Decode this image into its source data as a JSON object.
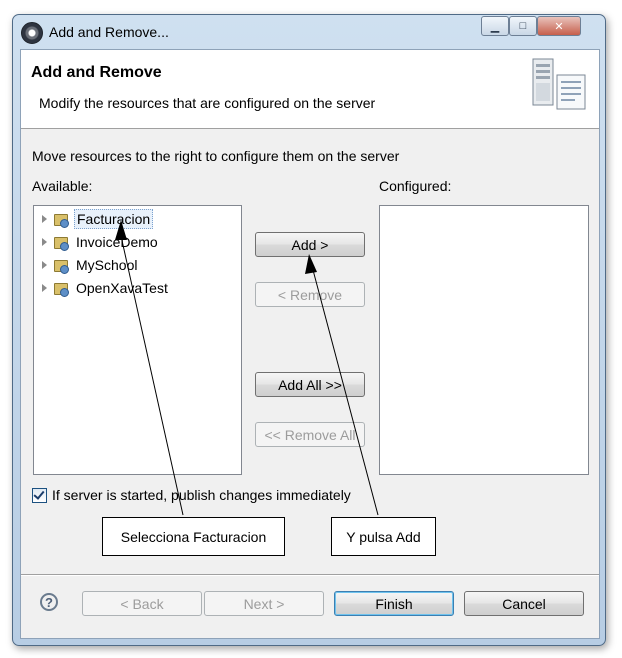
{
  "window": {
    "title": "Add and Remove...",
    "minimize_glyph": "▁",
    "maximize_glyph": "□",
    "close_glyph": "✕"
  },
  "banner": {
    "title": "Add and Remove",
    "description": "Modify the resources that are configured on the server",
    "icon": "server-icon"
  },
  "instructions": "Move resources to the right to configure them on the server",
  "available": {
    "label": "Available:",
    "items": [
      {
        "label": "Facturacion",
        "selected": true
      },
      {
        "label": "InvoiceDemo",
        "selected": false
      },
      {
        "label": "MySchool",
        "selected": false
      },
      {
        "label": "OpenXavaTest",
        "selected": false
      }
    ]
  },
  "configured": {
    "label": "Configured:",
    "items": []
  },
  "buttons": {
    "add": "Add >",
    "remove": "< Remove",
    "add_all": "Add All >>",
    "remove_all": "<< Remove All"
  },
  "publish_checkbox": {
    "label": "If server is started, publish changes immediately",
    "checked": true
  },
  "callouts": {
    "select": "Selecciona Facturacion",
    "press_add": "Y pulsa Add"
  },
  "footer": {
    "help_glyph": "?",
    "back": "< Back",
    "next": "Next >",
    "finish": "Finish",
    "cancel": "Cancel"
  }
}
